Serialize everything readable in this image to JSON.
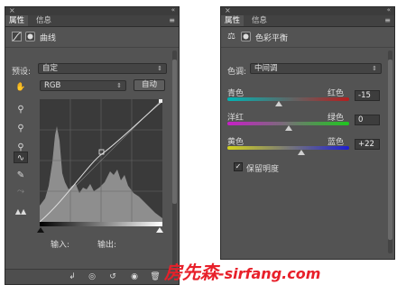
{
  "curves_panel": {
    "close": "×",
    "collapse": "«",
    "tabs": [
      {
        "label": "属性"
      },
      {
        "label": "信息"
      }
    ],
    "menu": "≡",
    "title": "曲线",
    "preset_label": "预设:",
    "preset_value": "自定",
    "channel_value": "RGB",
    "auto_button": "自动",
    "input_label": "输入:",
    "output_label": "输出:"
  },
  "color_balance_panel": {
    "close": "×",
    "collapse": "«",
    "tabs": [
      {
        "label": "属性"
      },
      {
        "label": "信息"
      }
    ],
    "menu": "≡",
    "title": "色彩平衡",
    "tone_label": "色调:",
    "tone_value": "中间调",
    "sliders": [
      {
        "left": "青色",
        "right": "红色",
        "value": "-15",
        "level": -15,
        "gradient": "#00b4b4,#b41e1e"
      },
      {
        "left": "洋红",
        "right": "绿色",
        "value": "0",
        "level": 0,
        "gradient": "#c81ec8,#1ec81e"
      },
      {
        "left": "黄色",
        "right": "蓝色",
        "value": "+22",
        "level": 22,
        "gradient": "#d2d21e,#1e1ed2"
      }
    ],
    "preserve_label": "保留明度",
    "preserve_checked": true
  },
  "watermark": {
    "text_cn": "房先森",
    "text_url": "-sirfang.com"
  }
}
